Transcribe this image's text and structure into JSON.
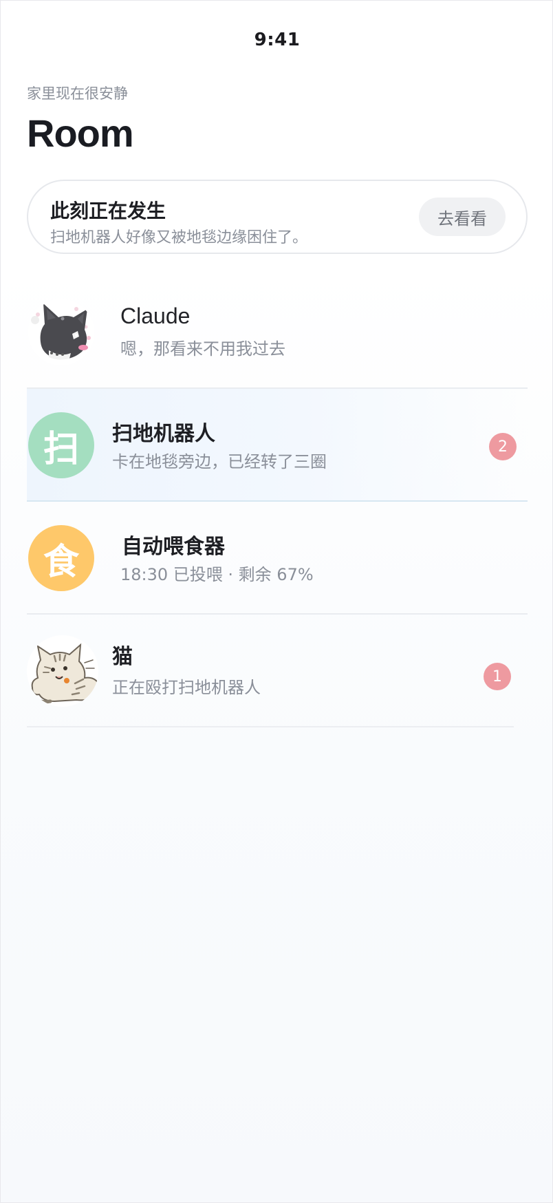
{
  "status_bar": {
    "time": "9:41"
  },
  "header": {
    "subtitle": "家里现在很安静",
    "title": "Room"
  },
  "happening": {
    "title": "此刻正在发生",
    "description": "扫地机器人好像又被地毯边缘困住了。",
    "button_label": "去看看"
  },
  "chats": [
    {
      "name": "Claude",
      "preview": "嗯，那看来不用我过去",
      "avatar_icon": "black-cat-sticker-icon",
      "unread": null
    },
    {
      "name": "扫地机器人",
      "preview": "卡在地毯旁边，已经转了三圈",
      "avatar_letter": "扫",
      "avatar_color": "#a4dec0",
      "unread": "2"
    },
    {
      "name": "自动喂食器",
      "preview": "18:30 已投喂 · 剩余 67%",
      "avatar_letter": "食",
      "avatar_color": "#fec86a",
      "unread": null
    },
    {
      "name": "猫",
      "preview": "正在殴打扫地机器人",
      "avatar_icon": "tabby-cat-sticker-icon",
      "unread": "1"
    }
  ],
  "colors": {
    "badge": "#ee9aa0",
    "highlight_row": "#eef5fd",
    "title_text": "#1a1c22",
    "secondary_text": "#8a8f99"
  }
}
